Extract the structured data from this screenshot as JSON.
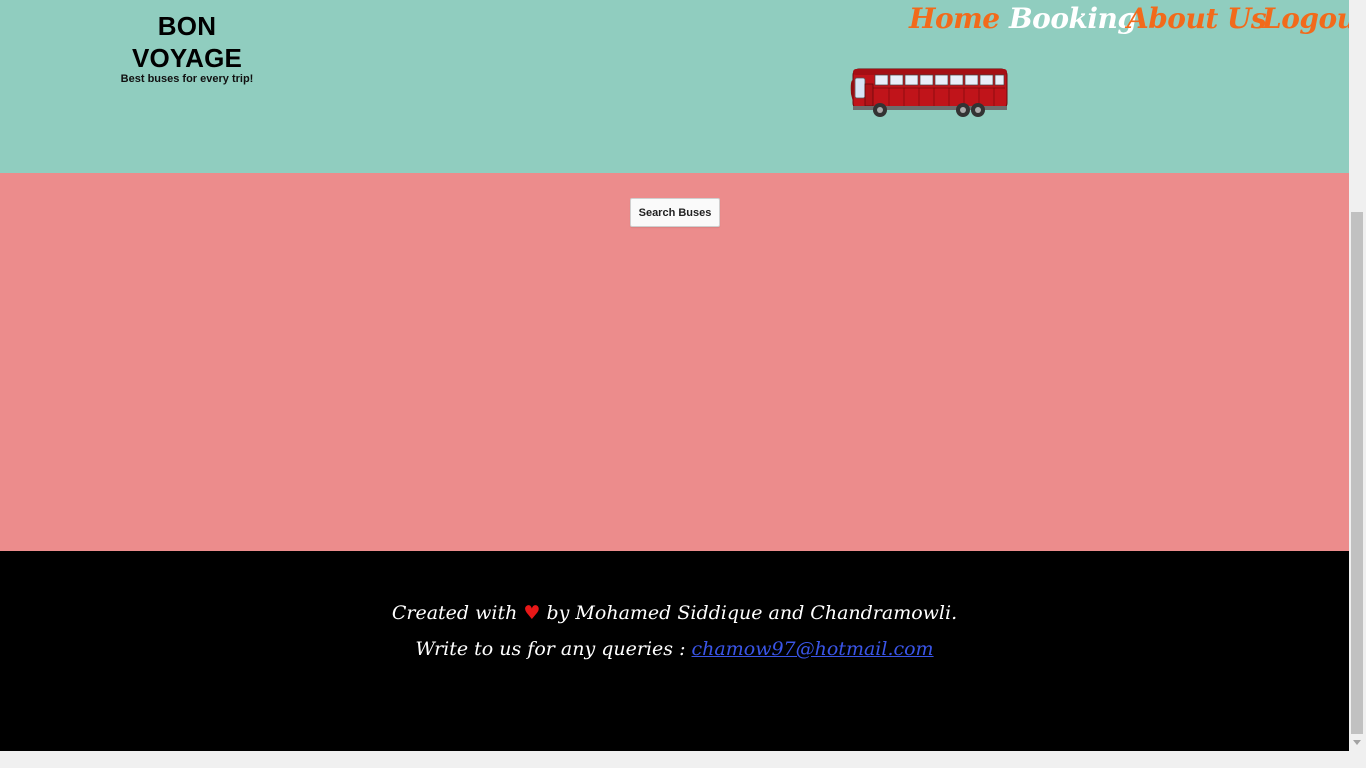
{
  "brand": {
    "title": "BON VOYAGE",
    "tagline": "Best buses for every trip!"
  },
  "nav": {
    "home": "Home",
    "booking": "Booking",
    "about": "About Us",
    "logout": "Logout"
  },
  "main": {
    "search_button": "Search Buses"
  },
  "footer": {
    "created_prefix": "Created with",
    "heart": "♥",
    "created_suffix": "by Mohamed Siddique and Chandramowli.",
    "contact_prefix": "Write to us for any queries :",
    "email": "chamow97@hotmail.com"
  },
  "colors": {
    "header_bg": "#90cdbf",
    "main_bg": "#ec8c8c",
    "footer_bg": "#000000",
    "nav_link": "#f26a1b",
    "nav_active": "#ffffff",
    "email_link": "#3a55e8"
  }
}
